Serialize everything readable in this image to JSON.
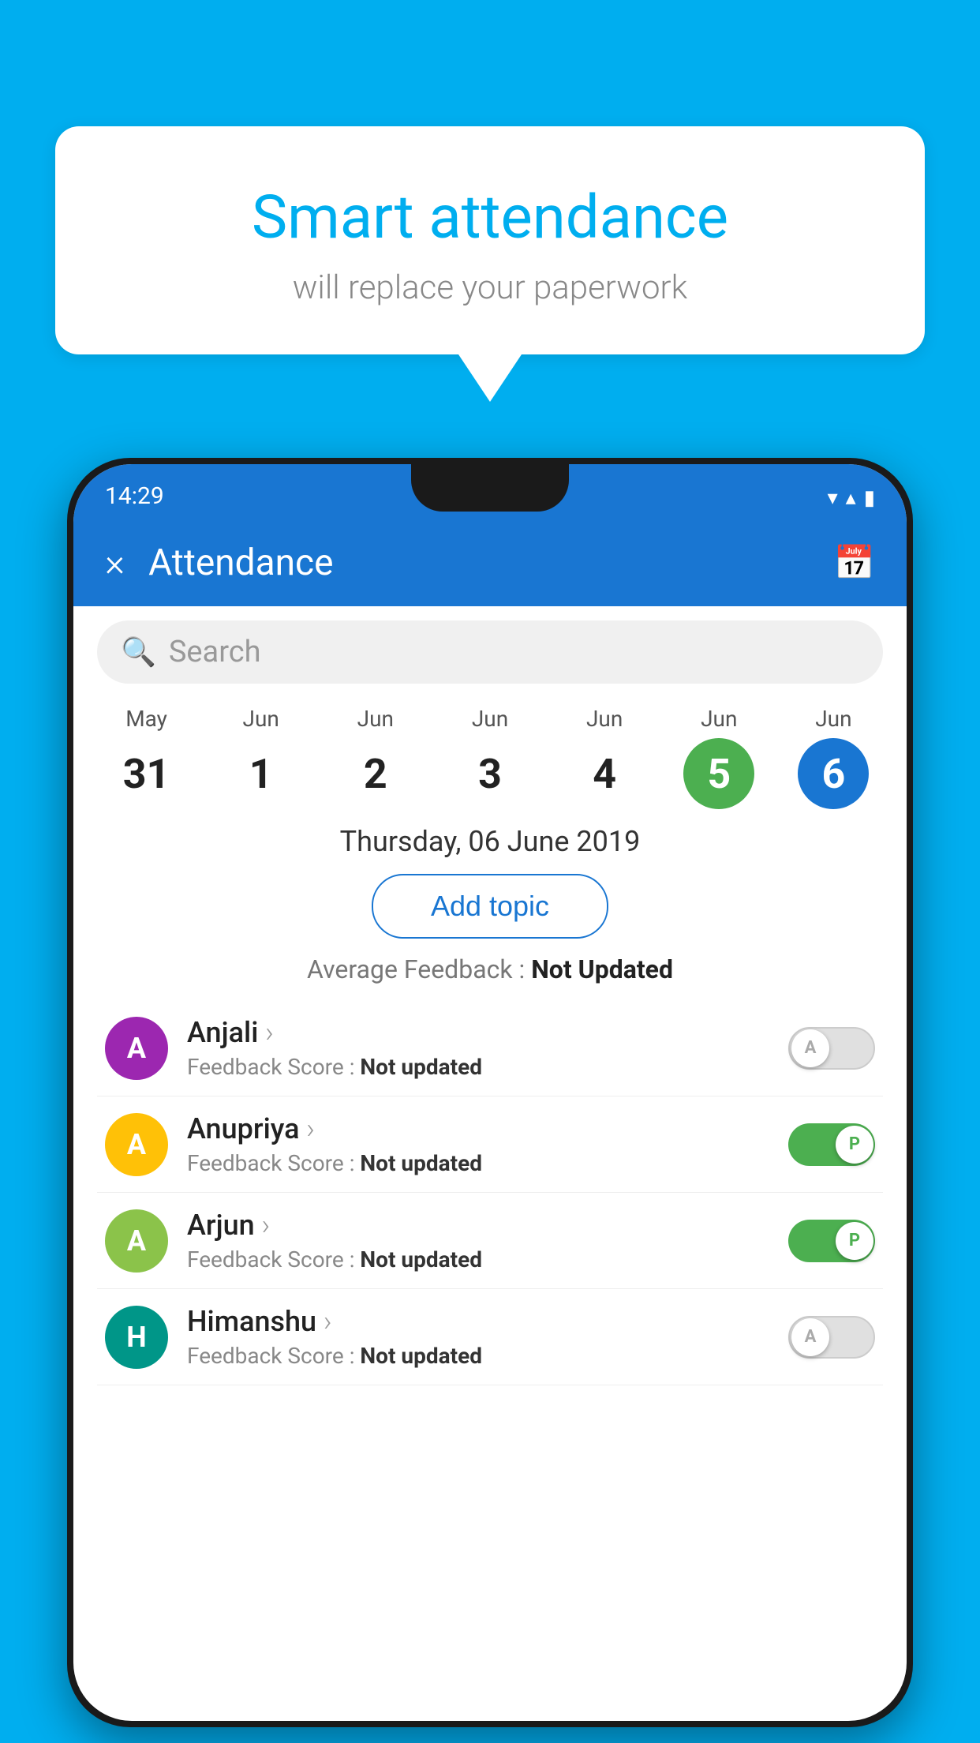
{
  "background_color": "#00AEEF",
  "speech_bubble": {
    "title": "Smart attendance",
    "subtitle": "will replace your paperwork"
  },
  "status_bar": {
    "time": "14:29",
    "wifi_icon": "▼",
    "signal_icon": "▲",
    "battery_icon": "▮"
  },
  "app_bar": {
    "title": "Attendance",
    "close_icon": "×",
    "calendar_icon": "📅"
  },
  "search": {
    "placeholder": "Search"
  },
  "date_strip": [
    {
      "month": "May",
      "day": "31",
      "state": "normal"
    },
    {
      "month": "Jun",
      "day": "1",
      "state": "normal"
    },
    {
      "month": "Jun",
      "day": "2",
      "state": "normal"
    },
    {
      "month": "Jun",
      "day": "3",
      "state": "normal"
    },
    {
      "month": "Jun",
      "day": "4",
      "state": "normal"
    },
    {
      "month": "Jun",
      "day": "5",
      "state": "today"
    },
    {
      "month": "Jun",
      "day": "6",
      "state": "selected"
    }
  ],
  "selected_date_label": "Thursday, 06 June 2019",
  "add_topic_label": "Add topic",
  "avg_feedback_label": "Average Feedback :",
  "avg_feedback_value": "Not Updated",
  "students": [
    {
      "name": "Anjali",
      "feedback_label": "Feedback Score :",
      "feedback_value": "Not updated",
      "avatar_letter": "A",
      "avatar_color": "avatar-purple",
      "toggle_state": "off",
      "toggle_label": "A"
    },
    {
      "name": "Anupriya",
      "feedback_label": "Feedback Score :",
      "feedback_value": "Not updated",
      "avatar_letter": "A",
      "avatar_color": "avatar-yellow",
      "toggle_state": "on",
      "toggle_label": "P"
    },
    {
      "name": "Arjun",
      "feedback_label": "Feedback Score :",
      "feedback_value": "Not updated",
      "avatar_letter": "A",
      "avatar_color": "avatar-green",
      "toggle_state": "on",
      "toggle_label": "P"
    },
    {
      "name": "Himanshu",
      "feedback_label": "Feedback Score :",
      "feedback_value": "Not updated",
      "avatar_letter": "H",
      "avatar_color": "avatar-teal",
      "toggle_state": "off",
      "toggle_label": "A"
    }
  ]
}
